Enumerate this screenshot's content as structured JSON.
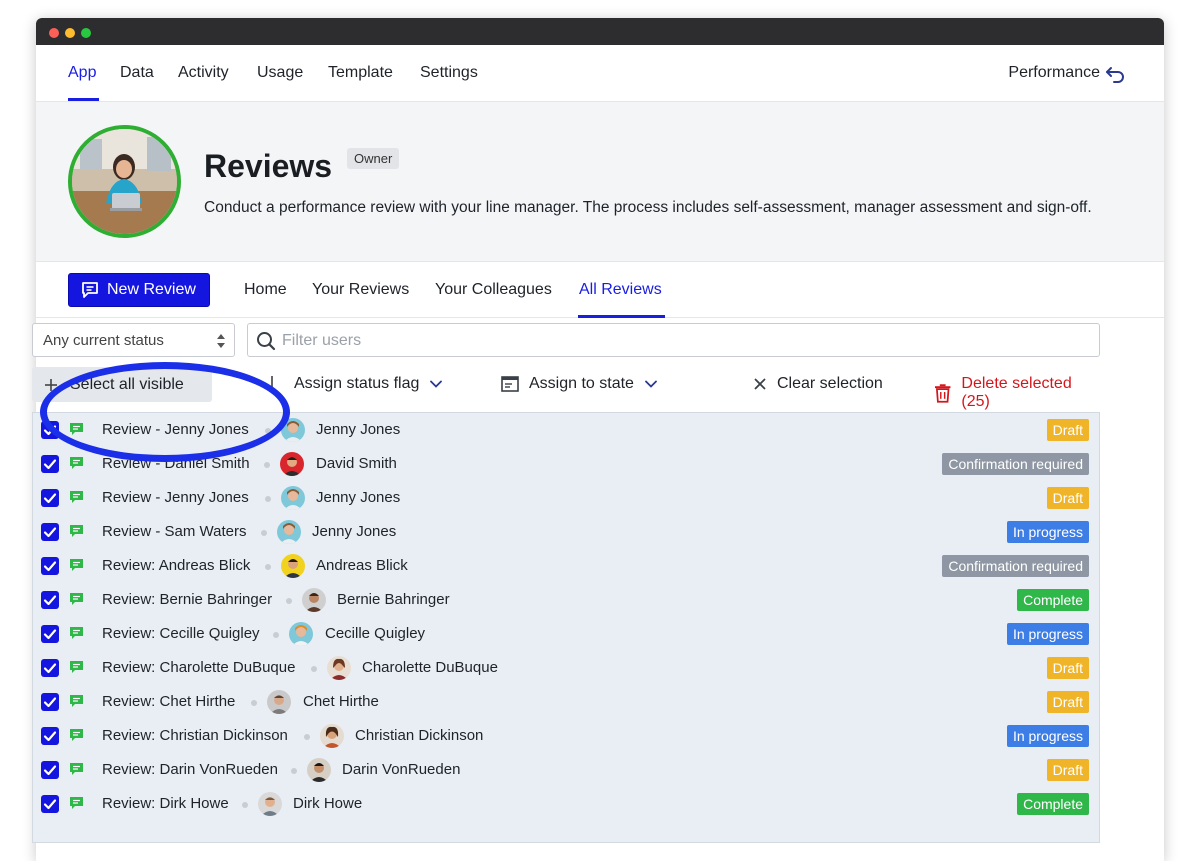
{
  "window": {
    "traffic_lights": [
      "close",
      "minimize",
      "zoom"
    ]
  },
  "topnav": {
    "items": [
      "App",
      "Data",
      "Activity",
      "Usage",
      "Template",
      "Settings"
    ],
    "active": "App",
    "right_label": "Performance",
    "right_icon": "return-arrow-icon"
  },
  "header": {
    "title": "Reviews",
    "badge": "Owner",
    "description": "Conduct a performance review with your line manager. The process includes self-assessment, manager assessment and sign-off."
  },
  "subnav": {
    "new_button": "New Review",
    "tabs": [
      "Home",
      "Your Reviews",
      "Your Colleagues",
      "All Reviews"
    ],
    "active": "All Reviews"
  },
  "filters": {
    "status_select_value": "Any current status",
    "filter_placeholder": "Filter users"
  },
  "actions": {
    "select_all": "Select all visible",
    "assign_flag": "Assign status flag",
    "assign_state": "Assign to state",
    "clear": "Clear selection",
    "delete": "Delete selected (25)"
  },
  "status_colors": {
    "Draft": "#f0b429",
    "Confirmation required": "#8e97a3",
    "In progress": "#3d7ee6",
    "Complete": "#2fb74a"
  },
  "rows": [
    {
      "title": "Review - Jenny Jones",
      "user": "Jenny Jones",
      "status": "Draft"
    },
    {
      "title": "Review - Daniel Smith",
      "user": "David Smith",
      "status": "Confirmation required"
    },
    {
      "title": "Review - Jenny Jones",
      "user": "Jenny Jones",
      "status": "Draft"
    },
    {
      "title": "Review - Sam Waters",
      "user": "Jenny Jones",
      "status": "In progress"
    },
    {
      "title": "Review: Andreas Blick",
      "user": "Andreas Blick",
      "status": "Confirmation required"
    },
    {
      "title": "Review: Bernie Bahringer",
      "user": "Bernie Bahringer",
      "status": "Complete"
    },
    {
      "title": "Review: Cecille Quigley",
      "user": "Cecille Quigley",
      "status": "In progress"
    },
    {
      "title": "Review: Charolette DuBuque",
      "user": "Charolette DuBuque",
      "status": "Draft"
    },
    {
      "title": "Review: Chet Hirthe",
      "user": "Chet Hirthe",
      "status": "Draft"
    },
    {
      "title": "Review: Christian Dickinson",
      "user": "Christian Dickinson",
      "status": "In progress"
    },
    {
      "title": "Review: Darin VonRueden",
      "user": "Darin VonRueden",
      "status": "Draft"
    },
    {
      "title": "Review: Dirk Howe",
      "user": "Dirk Howe",
      "status": "Complete"
    }
  ]
}
